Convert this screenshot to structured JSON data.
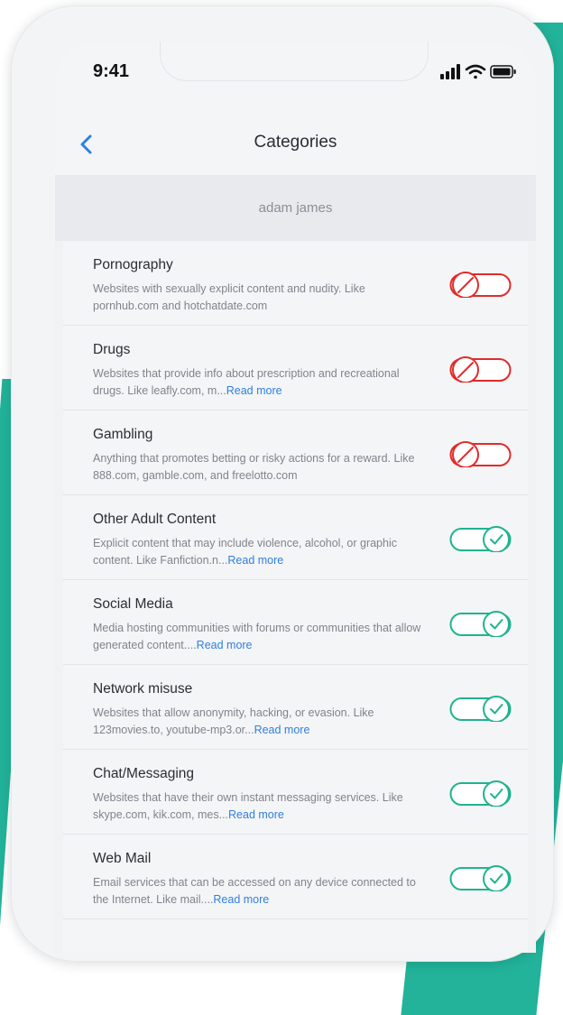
{
  "status_bar": {
    "time": "9:41"
  },
  "nav": {
    "title": "Categories"
  },
  "user": {
    "name": "adam james"
  },
  "colors": {
    "blocked": "#e22b2b",
    "allowed": "#1fb38f",
    "link": "#2f7fe0",
    "brand_bg": "#22b39a"
  },
  "categories": [
    {
      "title": "Pornography",
      "desc": "Websites with sexually explicit content and nudity. Like pornhub.com and hotchatdate.com",
      "read_more": "",
      "enabled": false
    },
    {
      "title": "Drugs",
      "desc": "Websites that provide info about prescription and recreational drugs. Like leafly.com, m...",
      "read_more": "Read more",
      "enabled": false
    },
    {
      "title": "Gambling",
      "desc": "Anything that promotes betting or risky actions for a reward. Like 888.com, gamble.com, and freelotto.com",
      "read_more": "",
      "enabled": false
    },
    {
      "title": "Other Adult Content",
      "desc": "Explicit content that may include violence, alcohol, or graphic content. Like Fanfiction.n...",
      "read_more": "Read more",
      "enabled": true
    },
    {
      "title": "Social Media",
      "desc": "Media hosting communities with forums or communities that allow generated content....",
      "read_more": "Read more",
      "enabled": true
    },
    {
      "title": "Network misuse",
      "desc": "Websites that allow anonymity, hacking, or evasion. Like 123movies.to, youtube-mp3.or...",
      "read_more": "Read more",
      "enabled": true
    },
    {
      "title": "Chat/Messaging",
      "desc": "Websites that have their own instant messaging services. Like skype.com, kik.com, mes...",
      "read_more": "Read more",
      "enabled": true
    },
    {
      "title": "Web Mail",
      "desc": "Email services that can be accessed on any device connected to the Internet. Like mail....",
      "read_more": "Read more",
      "enabled": true
    }
  ]
}
